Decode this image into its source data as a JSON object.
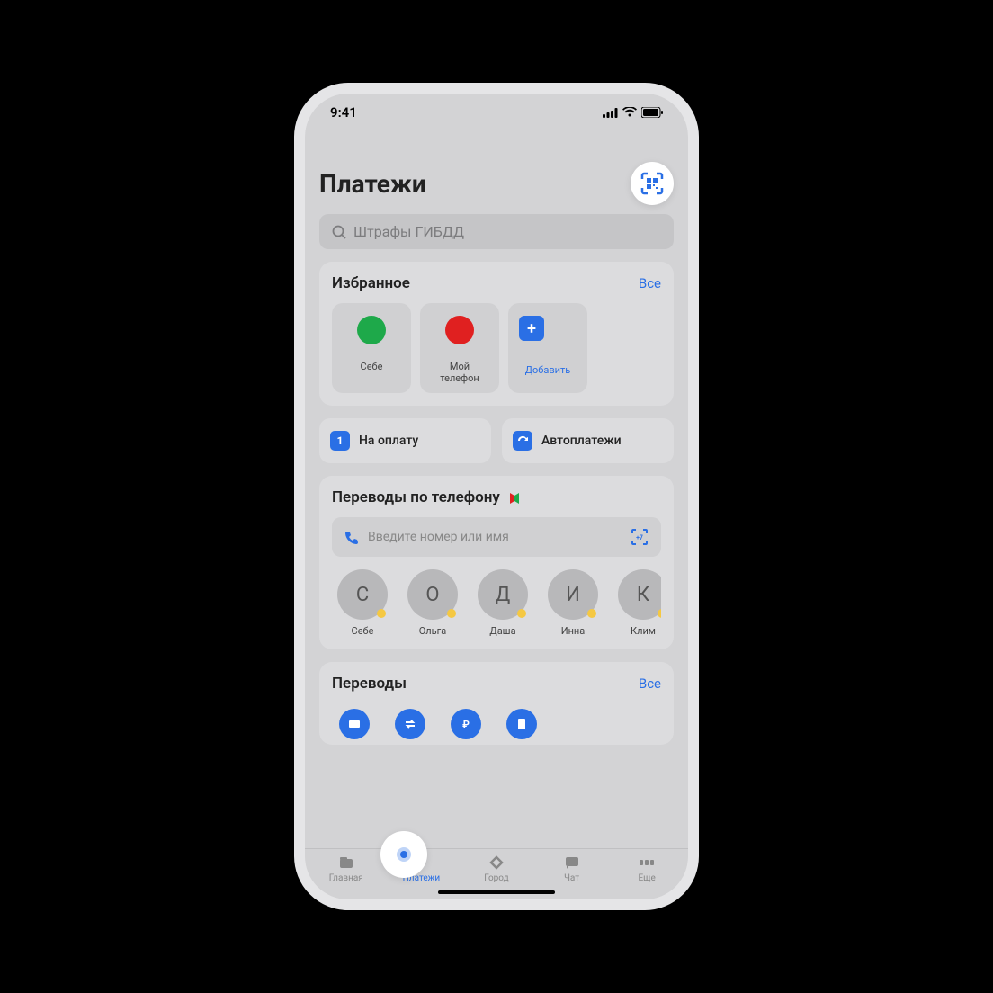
{
  "status": {
    "time": "9:41"
  },
  "header": {
    "title": "Платежи"
  },
  "search": {
    "placeholder": "Штрафы ГИБДД"
  },
  "favorites": {
    "title": "Избранное",
    "all": "Все",
    "items": [
      {
        "label": "Себе",
        "color": "#1ea94a"
      },
      {
        "label": "Мой телефон",
        "color": "#e02020"
      },
      {
        "label": "Добавить",
        "add": true
      }
    ]
  },
  "actions": {
    "pay": {
      "label": "На оплату",
      "badge": "1"
    },
    "auto": {
      "label": "Автоплатежи"
    }
  },
  "phone_transfers": {
    "title": "Переводы по телефону",
    "input_placeholder": "Введите номер или имя",
    "contacts": [
      {
        "initial": "С",
        "name": "Себе"
      },
      {
        "initial": "О",
        "name": "Ольга"
      },
      {
        "initial": "Д",
        "name": "Даша"
      },
      {
        "initial": "И",
        "name": "Инна"
      },
      {
        "initial": "К",
        "name": "Клим"
      }
    ]
  },
  "transfers": {
    "title": "Переводы",
    "all": "Все"
  },
  "tabs": {
    "0": {
      "label": "Главная"
    },
    "1": {
      "label": "Платежи"
    },
    "2": {
      "label": "Город"
    },
    "3": {
      "label": "Чат"
    },
    "4": {
      "label": "Еще"
    }
  }
}
